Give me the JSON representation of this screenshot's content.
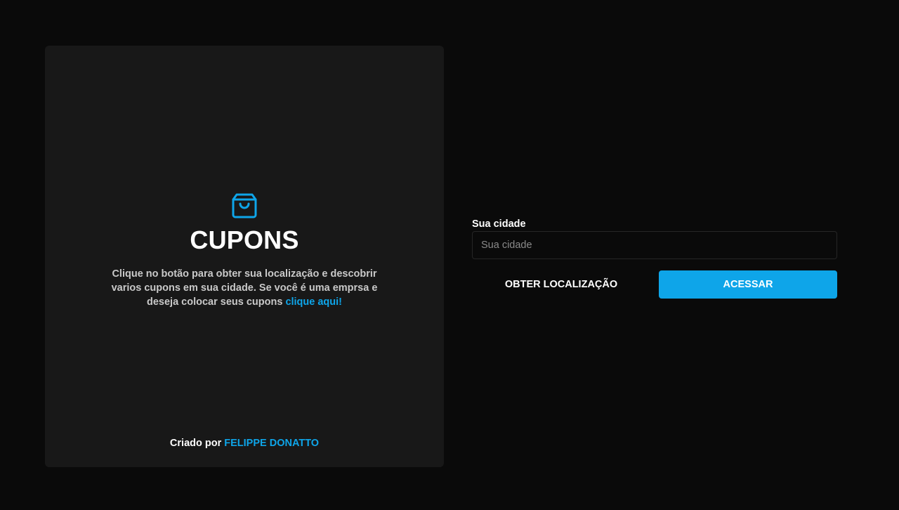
{
  "hero": {
    "title": "CUPONS",
    "description": "Clique no botão para obter sua localização e descobrir varios cupons em sua cidade. Se você é uma emprsa e deseja colocar seus cupons ",
    "link_label": "clique aqui!",
    "icon": "shopping-bag-icon",
    "accent_color": "#0ea5e9"
  },
  "credit": {
    "prefix": "Criado por ",
    "author": "FELIPPE DONATTO"
  },
  "form": {
    "city_label": "Sua cidade",
    "city_placeholder": "Sua cidade",
    "city_value": "",
    "locate_button": "OBTER LOCALIZAÇÃO",
    "access_button": "ACESSAR"
  }
}
